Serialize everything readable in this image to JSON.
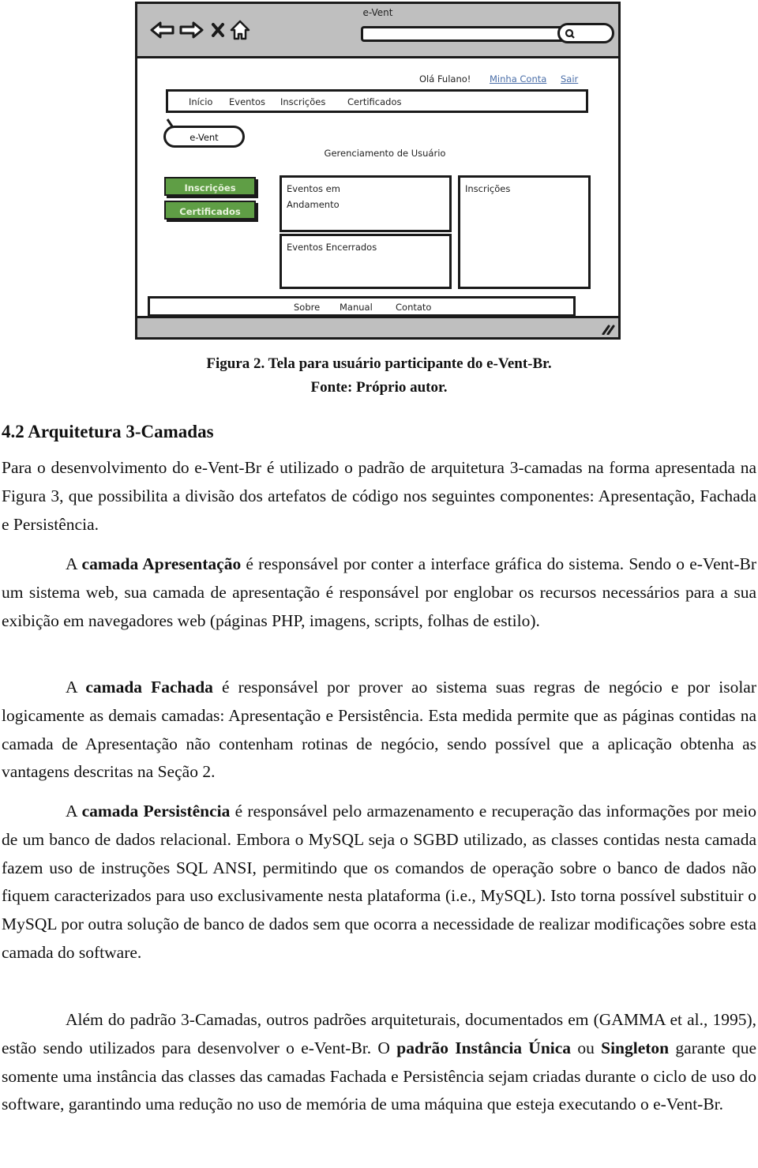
{
  "figure": {
    "mockup": {
      "window_title": "e-Vent",
      "toolbar_icons": [
        "back-arrow-icon",
        "forward-arrow-icon",
        "close-x-icon",
        "home-icon"
      ],
      "url_bar_value": "",
      "search_icon": "search-icon",
      "greeting": "Olá Fulano!",
      "account_links": [
        "Minha Conta",
        "Sair"
      ],
      "top_menu": [
        "Início",
        "Eventos",
        "Inscrições",
        "Certificados"
      ],
      "logo_bubble": "e-Vent",
      "section_title": "Gerenciamento de Usuário",
      "side_buttons": [
        "Inscrições",
        "Certificados"
      ],
      "side_button_color": "#5f9e45",
      "panels": {
        "ongoing_line1": "Eventos em",
        "ongoing_line2": "Andamento",
        "closed": "Eventos Encerrados",
        "registrations": "Inscrições"
      },
      "footer_links": [
        "Sobre",
        "Manual",
        "Contato"
      ],
      "link_color": "#4a6ea8",
      "chrome_color": "#bfbfbf"
    },
    "caption_line1": "Figura 2. Tela para usuário participante do e-Vent-Br.",
    "caption_line2": "Fonte: Próprio autor."
  },
  "section": {
    "heading": "4.2 Arquitetura 3-Camadas",
    "paragraphs": [
      {
        "parts": [
          {
            "t": "Para o desenvolvimento do e-Vent-Br é utilizado o padrão de arquitetura 3-camadas na forma apresentada na Figura 3, que possibilita a divisão dos artefatos de código nos seguintes componentes: Apresentação, Fachada e Persistência.",
            "b": false
          }
        ]
      },
      {
        "parts": [
          {
            "t": "A ",
            "b": false
          },
          {
            "t": "camada Apresentação",
            "b": true
          },
          {
            "t": " é responsável por conter a interface gráfica do sistema. Sendo o e-Vent-Br um sistema web, sua camada de apresentação é responsável por englobar os recursos necessários para a sua exibição em navegadores web (páginas PHP, imagens, scripts, folhas de estilo).",
            "b": false
          }
        ]
      },
      {
        "parts": [
          {
            "t": "A ",
            "b": false
          },
          {
            "t": "camada Fachada",
            "b": true
          },
          {
            "t": " é responsável por prover ao sistema suas regras de negócio e por isolar logicamente as demais camadas: Apresentação e Persistência. Esta medida permite que as páginas contidas na camada de Apresentação não contenham rotinas de negócio, sendo possível que a aplicação obtenha as vantagens descritas na Seção 2.",
            "b": false
          }
        ]
      },
      {
        "parts": [
          {
            "t": "A ",
            "b": false
          },
          {
            "t": "camada Persistência",
            "b": true
          },
          {
            "t": " é responsável pelo armazenamento e recuperação das informações por meio de um banco de dados relacional. Embora o MySQL seja o SGBD utilizado, as classes contidas nesta camada fazem uso de instruções SQL ANSI, permitindo que os comandos de operação sobre o banco de dados não fiquem caracterizados para uso exclusivamente nesta plataforma (i.e., MySQL). Isto torna possível substituir o MySQL por outra solução de banco de dados sem que ocorra a necessidade de realizar modificações sobre esta camada do software.",
            "b": false
          }
        ]
      },
      {
        "parts": [
          {
            "t": "Além do padrão 3-Camadas, outros padrões arquiteturais, documentados em (GAMMA et al., 1995), estão sendo utilizados para desenvolver o e-Vent-Br. O ",
            "b": false
          },
          {
            "t": "padrão Instância Única",
            "b": true
          },
          {
            "t": " ou ",
            "b": false
          },
          {
            "t": "Singleton",
            "b": true
          },
          {
            "t": " garante que somente uma instância das classes das camadas Fachada e Persistência sejam criadas durante o ciclo de uso do software, garantindo uma redução no uso de memória de uma máquina que esteja executando o e-Vent-Br.",
            "b": false
          }
        ]
      }
    ]
  }
}
